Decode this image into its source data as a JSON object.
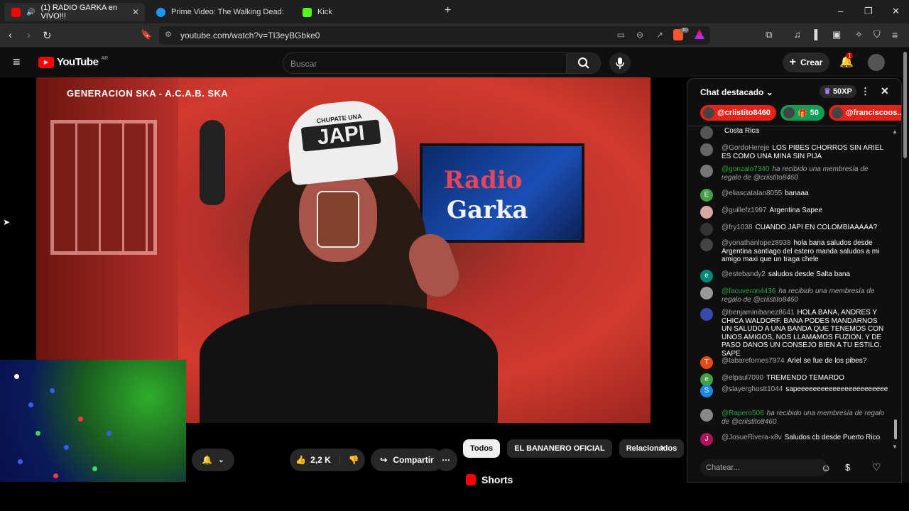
{
  "browser": {
    "tabs": [
      {
        "label": "(1) RADIO GARKA en VIVO!!!",
        "active": true,
        "color": "#ff0000"
      },
      {
        "label": "Prime Video: The Walking Dead: Dea",
        "active": false,
        "color": "#1a98ff"
      },
      {
        "label": "Kick",
        "active": false,
        "color": "#53fc18"
      }
    ],
    "new_tab": "+",
    "url": "youtube.com/watch?v=TI3eyBGbke0",
    "brave_badge": "40"
  },
  "youtube": {
    "logo_text": "YouTube",
    "country": "AR",
    "search_placeholder": "Buscar",
    "create_label": "Crear",
    "notification_count": "1"
  },
  "video": {
    "overlay_text": "GENERACION SKA - A.C.A.B. SKA",
    "cap_line1": "CHUPATE UNA",
    "cap_line2": "JAPI",
    "tv_line1": "Radio",
    "tv_line2": "Garka"
  },
  "actions": {
    "likes": "2,2 K",
    "share": "Compartir"
  },
  "chips": [
    "Todos",
    "EL BANANERO OFICIAL",
    "Relacionados"
  ],
  "shorts_label": "Shorts",
  "chat": {
    "title": "Chat destacado",
    "xp": "50XP",
    "pinned": [
      {
        "label": "@criistito8460",
        "color": "#e62117"
      },
      {
        "label": "50",
        "color": "#0f9d58"
      },
      {
        "label": "@franciscoos...",
        "color": "#e62117"
      }
    ],
    "messages": [
      {
        "user": "",
        "text": "Costa Rica",
        "avatar": "",
        "avcolor": "#555",
        "gift": false
      },
      {
        "user": "@GordoHereje",
        "text": "LOS PIBES CHORROS SIN ARIEL ES COMO UNA MINA SIN PIJA",
        "avatar": "",
        "avcolor": "#666",
        "gift": false
      },
      {
        "user": "@gonzalo7340",
        "text": "ha recibido una membresía de regalo de @criistito8460",
        "avatar": "",
        "avcolor": "#777",
        "gift": true
      },
      {
        "user": "@eliascatalan8055",
        "text": "banaaa",
        "avatar": "E",
        "avcolor": "#43a047",
        "gift": false
      },
      {
        "user": "@guillefz1997",
        "text": "Argentina Sapee",
        "avatar": "",
        "avcolor": "#d9a9a0",
        "gift": false
      },
      {
        "user": "@fry1038",
        "text": "CUANDO JAPI EN COLOMBIAAAAA?",
        "avatar": "",
        "avcolor": "#333",
        "gift": false
      },
      {
        "user": "@yonathanlopez8938",
        "text": "hola bana saludos desde Argentina santiago del estero manda saludos a mi amigo maxi que un traga chele",
        "avatar": "",
        "avcolor": "#444",
        "gift": false
      },
      {
        "user": "@estebandy2",
        "text": "saludos desde Salta bana",
        "avatar": "e",
        "avcolor": "#00897b",
        "gift": false
      },
      {
        "user": "@facuveron4436",
        "text": "ha recibido una membresía de regalo de @criistito8460",
        "avatar": "",
        "avcolor": "#999",
        "gift": true
      },
      {
        "user": "@benjaminibanez8641",
        "text": "HOLA BANA, ANDRES Y CHICA WALDORF. BANA PODES MANDARNOS UN SALUDO A UNA BANDA QUE TENEMOS CON UNOS AMIGOS, NOS LLAMAMOS FUZION. Y DE PASO DANOS UN CONSEJO BIEN A TU ESTILO. SAPE",
        "avatar": "",
        "avcolor": "#3949ab",
        "gift": false
      },
      {
        "user": "@tabarefornes7974",
        "text": "Ariel se fue de los pibes?",
        "avatar": "T",
        "avcolor": "#e64a19",
        "gift": false
      },
      {
        "user": "@elpaul7090",
        "text": "TREMENDO TEMARDO",
        "avatar": "e",
        "avcolor": "#43a047",
        "gift": false
      },
      {
        "user": "@slayerghostt1044",
        "text": "sapeeeeeeeeeeeeeeeeeeeeeee",
        "avatar": "S",
        "avcolor": "#1e88e5",
        "gift": false
      },
      {
        "user": "@Rapero506",
        "text": "ha recibido una membresía de regalo de @criistito8460",
        "avatar": "",
        "avcolor": "#888",
        "gift": true
      },
      {
        "user": "@JosueRivera-x8v",
        "text": "Saludos cb desde Puerto Rico",
        "avatar": "J",
        "avcolor": "#ad1457",
        "gift": false
      }
    ],
    "input_placeholder": "Chatear..."
  }
}
